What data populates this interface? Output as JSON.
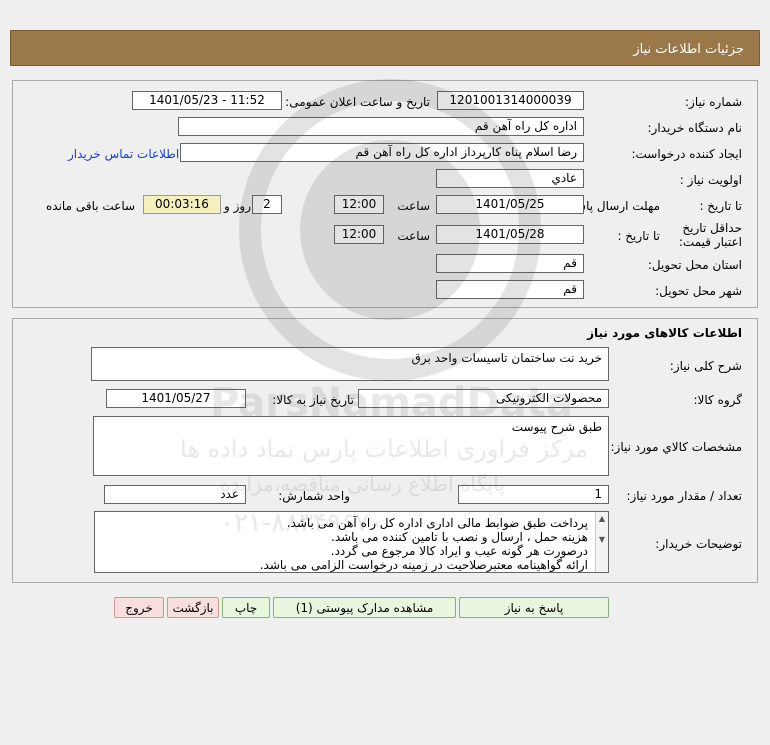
{
  "header": {
    "title": "جزئیات اطلاعات نیاز"
  },
  "info": {
    "need_number_label": "شماره نیاز:",
    "need_number": "1201001314000039",
    "announce_label": "تاریخ و ساعت اعلان عمومی:",
    "announce_value": "1401/05/23 - 11:52",
    "buyer_org_label": "نام دستگاه خریدار:",
    "buyer_org": "اداره کل  راه آهن قم",
    "creator_label": "ایجاد کننده درخواست:",
    "creator": "رضا اسلام پناه کارپرداز اداره کل  راه آهن قم",
    "contact_link": "اطلاعات تماس خریدار",
    "priority_label": "اولویت نیاز :",
    "priority": "عادي",
    "send_deadline_label": "مهلت ارسال پاسخ:",
    "to_date_label": "تا تاریخ :",
    "send_date": "1401/05/25",
    "hour_label": "ساعت",
    "send_time": "12:00",
    "days": "2",
    "days_label": "روز و",
    "remaining": "00:03:16",
    "remaining_label": "ساعت باقی مانده",
    "validity_label": "حداقل تاریخ اعتبار قیمت:",
    "validity_to_label": "تا تاریخ :",
    "validity_date": "1401/05/28",
    "validity_hour_label": "ساعت",
    "validity_time": "12:00",
    "province_label": "استان محل تحویل:",
    "province": "قم",
    "city_label": "شهر محل تحویل:",
    "city": "قم"
  },
  "goods": {
    "title": "اطلاعات کالاهای مورد نیاز",
    "desc_label": "شرح کلی نیاز:",
    "desc": "خرید نت ساختمان تاسیسات واحد برق",
    "group_label": "گروه کالا:",
    "group": "محصولات الکترونیکی",
    "need_date_label": "تاریخ نیاز به کالا:",
    "need_date": "1401/05/27",
    "spec_label": "مشخصات کالاي مورد نیاز:",
    "spec": "طبق شرح پیوست",
    "qty_label": "تعداد / مقدار مورد نیاز:",
    "qty": "1",
    "unit_label": "واحد شمارش:",
    "unit": "عدد",
    "notes_label": "توضیحات خریدار:",
    "notes": [
      "پرداخت طبق ضوابط مالی اداری اداره کل راه آهن می باشد.",
      "هزینه حمل ، ارسال و نصب با تامین کننده می باشد.",
      "درصورت هر گونه عیب و ایراد کالا مرجوع می گردد.",
      "ارائه گواهینامه معتبرصلاحیت در زمینه درخواست الزامی می باشد."
    ]
  },
  "buttons": {
    "reply": "پاسخ به نیاز",
    "attachments": "مشاهده مدارک پیوستی (1)",
    "print": "چاپ",
    "back": "بازگشت",
    "exit": "خروج"
  },
  "watermark": {
    "brand": "ParsNamadData",
    "line1": "مرکز فراوری اطلاعات پارس نماد داده ها",
    "line2": "پایگاه اطلاع رسانی مناقصه،مزایده",
    "phone": "۰۲۱-۸۸۳۴۹۶۷۰"
  },
  "colors": {
    "header": "#9b7849",
    "link": "#1a3fc0",
    "timer": "#f5f0c0"
  }
}
